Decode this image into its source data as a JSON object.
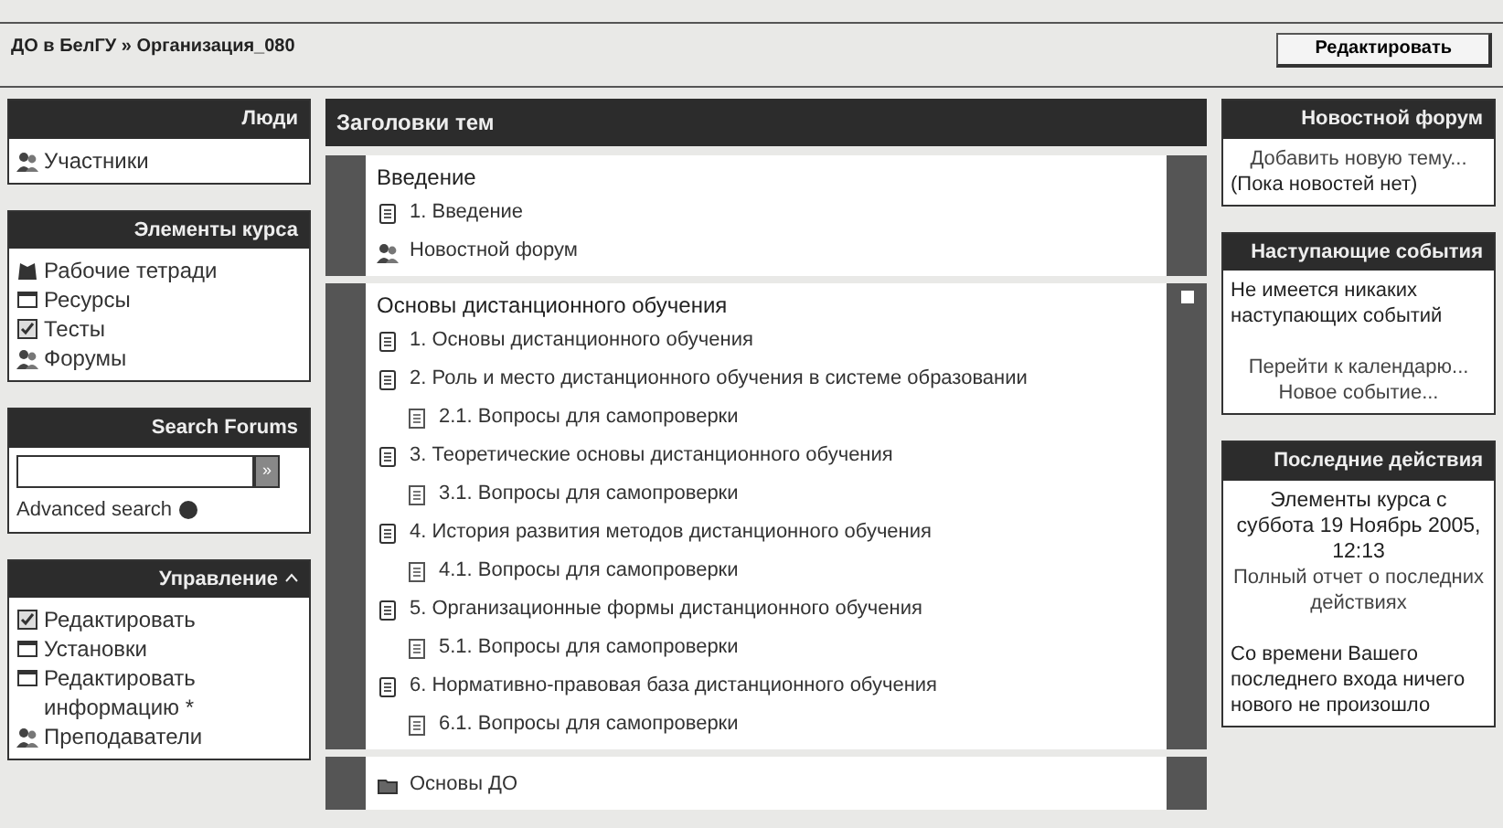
{
  "breadcrumb": "ДО в БелГУ » Организация_080",
  "edit_button": "Редактировать",
  "left_blocks": [
    {
      "kind": "list",
      "title": "Люди",
      "items": [
        {
          "label": "Участники",
          "kind": "people"
        }
      ]
    },
    {
      "kind": "list",
      "title": "Элементы курса",
      "items": [
        {
          "label": "Рабочие тетради",
          "kind": "book"
        },
        {
          "label": "Ресурсы",
          "kind": "window"
        },
        {
          "label": "Тесты",
          "kind": "check"
        },
        {
          "label": "Форумы",
          "kind": "people"
        }
      ]
    },
    {
      "kind": "search",
      "title": "Search Forums",
      "button": "»",
      "link": "Advanced search"
    },
    {
      "kind": "list",
      "title": "Управление",
      "collapsible": true,
      "items": [
        {
          "label": "Редактировать",
          "kind": "check"
        },
        {
          "label": "Установки",
          "kind": "window"
        },
        {
          "label": "Редактировать информацию *",
          "kind": "window"
        },
        {
          "label": "Преподаватели",
          "kind": "people"
        }
      ]
    }
  ],
  "topics": {
    "title": "Заголовки тем",
    "sections": [
      {
        "highlighted": false,
        "items": [
          {
            "kind": "heading",
            "label": "Введение"
          },
          {
            "kind": "page",
            "label": "1. Введение"
          },
          {
            "kind": "forum",
            "label": "Новостной форум"
          }
        ]
      },
      {
        "highlighted": true,
        "items": [
          {
            "kind": "heading",
            "label": "Основы дистанционного обучения"
          },
          {
            "kind": "page",
            "label": "1. Основы дистанционного обучения"
          },
          {
            "kind": "page",
            "label": "2. Роль и место дистанционного обучения в системе образовании"
          },
          {
            "kind": "sub",
            "label": "2.1. Вопросы для самопроверки"
          },
          {
            "kind": "page",
            "label": "3. Теоретические основы дистанционного обучения"
          },
          {
            "kind": "sub",
            "label": "3.1. Вопросы для самопроверки"
          },
          {
            "kind": "page",
            "label": "4. История развития методов дистанционного обучения"
          },
          {
            "kind": "sub",
            "label": "4.1. Вопросы для самопроверки"
          },
          {
            "kind": "page",
            "label": "5. Организационные формы дистанционного обучения"
          },
          {
            "kind": "sub",
            "label": "5.1. Вопросы для самопроверки"
          },
          {
            "kind": "page",
            "label": "6. Нормативно-правовая база дистанционного обучения"
          },
          {
            "kind": "sub",
            "label": "6.1. Вопросы для самопроверки"
          }
        ]
      },
      {
        "highlighted": false,
        "items": [
          {
            "kind": "folder",
            "label": "Основы ДО"
          }
        ]
      }
    ]
  },
  "right_blocks": [
    {
      "title": "Новостной форум",
      "lines": [
        {
          "kind": "link",
          "text": "Добавить новую тему..."
        },
        {
          "kind": "text",
          "text": "(Пока новостей нет)"
        }
      ]
    },
    {
      "title": "Наступающие события",
      "lines": [
        {
          "kind": "text",
          "text": "Не имеется никаких наступающих событий"
        },
        {
          "kind": "gap"
        },
        {
          "kind": "link",
          "text": "Перейти к календарю..."
        },
        {
          "kind": "link",
          "text": "Новое событие..."
        }
      ]
    },
    {
      "title": "Последние действия",
      "lines": [
        {
          "kind": "center",
          "text": "Элементы курса с суббота 19 Ноябрь 2005, 12:13"
        },
        {
          "kind": "link",
          "text": "Полный отчет о последних действиях"
        },
        {
          "kind": "gap"
        },
        {
          "kind": "text",
          "text": "Со времени Вашего последнего входа ничего нового не произошло"
        }
      ]
    }
  ]
}
